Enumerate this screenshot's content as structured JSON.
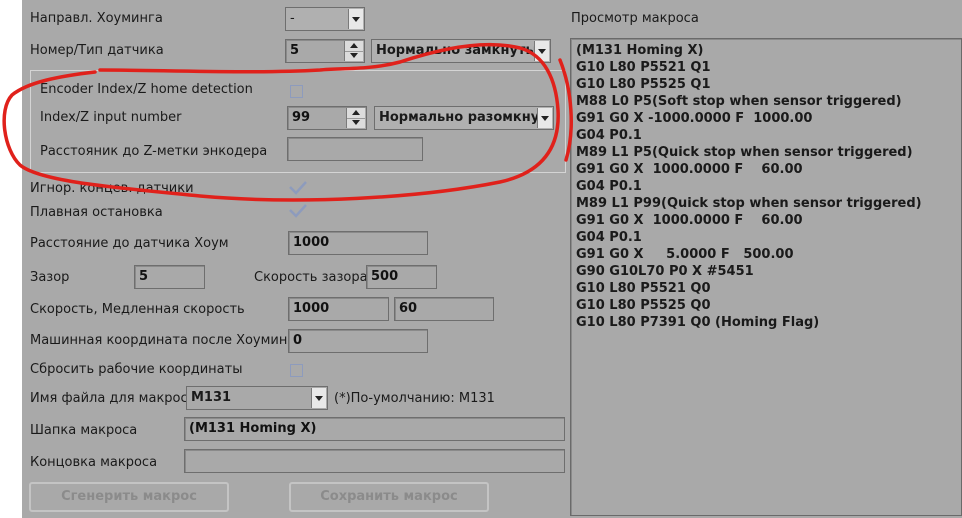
{
  "labels": {
    "homing_dir": "Направл. Хоуминга",
    "sensor": "Номер/Тип датчика",
    "encoder": "Encoder Index/Z home detection",
    "index_input": "Index/Z input number",
    "z_distance": "Расстояник до Z-метки энкодера",
    "ignore_limits": "Игнор. концев. датчики",
    "smooth_stop": "Плавная остановка",
    "dist_home": "Расстояние до датчика Хоум",
    "gap": "Зазор",
    "gap_speed": "Скорость зазора",
    "speeds": "Скорость, Медленная скорость",
    "machine_coord": "Машинная координата после Хоуминга",
    "reset_work": "Сбросить рабочие координаты",
    "macro_file": "Имя файла для макроса",
    "default_note": "(*)По-умолчанию: М131",
    "header": "Шапка макроса",
    "footer": "Концовка макроса",
    "preview_title": "Просмотр макроса"
  },
  "values": {
    "homing_dir": "-",
    "sensor_num": "5",
    "sensor_type": "Нормально замкнуты",
    "index_input": "99",
    "index_type": "Нормально разомкну",
    "z_distance": "",
    "dist_home": "1000",
    "gap": "5",
    "gap_speed": "500",
    "speed": "1000",
    "slow_speed": "60",
    "machine_coord": "0",
    "macro_file": "M131",
    "header": "(M131 Homing X)",
    "footer": ""
  },
  "checkboxes": {
    "encoder": false,
    "ignore_limits": true,
    "smooth_stop": true,
    "reset_work": false
  },
  "buttons": {
    "generate": "Сгенерить макрос",
    "save": "Сохранить макрос"
  },
  "preview_lines": [
    "(M131 Homing X)",
    "G10 L80 P5521 Q1",
    "G10 L80 P5525 Q1",
    "M88 L0 P5(Soft stop when sensor triggered)",
    "G91 G0 X -1000.0000 F  1000.00",
    "G04 P0.1",
    "M89 L1 P5(Quick stop when sensor triggered)",
    "G91 G0 X  1000.0000 F    60.00",
    "G04 P0.1",
    "M89 L1 P99(Quick stop when sensor triggered)",
    "G91 G0 X  1000.0000 F    60.00",
    "G04 P0.1",
    "G91 G0 X     5.0000 F   500.00",
    "G90 G10L70 P0 X #5451",
    "G10 L80 P5521 Q0",
    "G10 L80 P5525 Q0",
    "G10 L80 P7391 Q0 (Homing Flag)"
  ],
  "colors": {
    "panel": "#a9a9a9",
    "annotation": "#e0211b",
    "checkbox_border": "#8d9bbd"
  }
}
